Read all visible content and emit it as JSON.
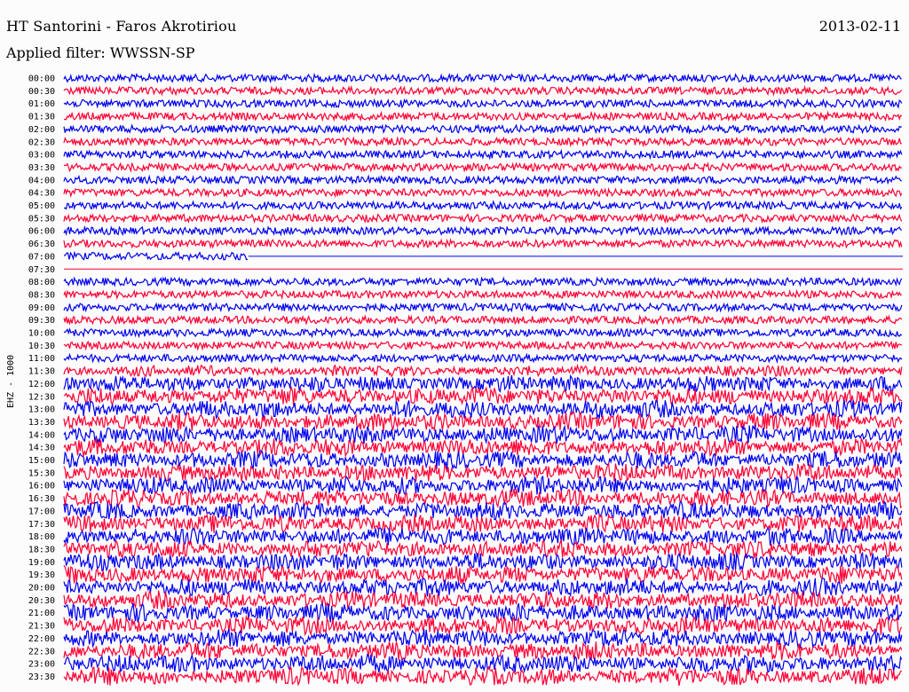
{
  "header": {
    "station": "HT Santorini - Faros Akrotiriou",
    "date": "2013-02-11",
    "filter": "Applied filter: WWSSN-SP",
    "channel": "EHZ - 1000"
  },
  "colors": {
    "traceA": "#0000ee",
    "traceB": "#ff0033",
    "background": "#fcfcfc"
  },
  "chart_data": {
    "type": "helicorder",
    "row_labels": [
      "00:00",
      "00:30",
      "01:00",
      "01:30",
      "02:00",
      "02:30",
      "03:00",
      "03:30",
      "04:00",
      "04:30",
      "05:00",
      "05:30",
      "06:00",
      "06:30",
      "07:00",
      "07:30",
      "08:00",
      "08:30",
      "09:00",
      "09:30",
      "10:00",
      "10:30",
      "11:00",
      "11:30",
      "12:00",
      "12:30",
      "13:00",
      "13:30",
      "14:00",
      "14:30",
      "15:00",
      "15:30",
      "16:00",
      "16:30",
      "17:00",
      "17:30",
      "18:00",
      "18:30",
      "19:00",
      "19:30",
      "20:00",
      "20:30",
      "21:00",
      "21:30",
      "22:00",
      "22:30",
      "23:00",
      "23:30"
    ],
    "trace_colors_alternate": [
      "blue",
      "red"
    ],
    "relative_amplitude": [
      1,
      1,
      1,
      1,
      1,
      1,
      1,
      1,
      1,
      1,
      1,
      1,
      1,
      1,
      1,
      0.05,
      1,
      1,
      1,
      1,
      1,
      1,
      1,
      1.6,
      2.4,
      2.6,
      2.6,
      2.6,
      2.6,
      2.6,
      2.6,
      2.6,
      2.6,
      2.6,
      2.6,
      2.6,
      2.6,
      2.6,
      2.6,
      2.6,
      2.6,
      2.6,
      2.6,
      2.6,
      2.6,
      2.6,
      2.6,
      2.6
    ],
    "data_gap_row": "07:00",
    "data_gap_start_fraction": 0.22
  }
}
